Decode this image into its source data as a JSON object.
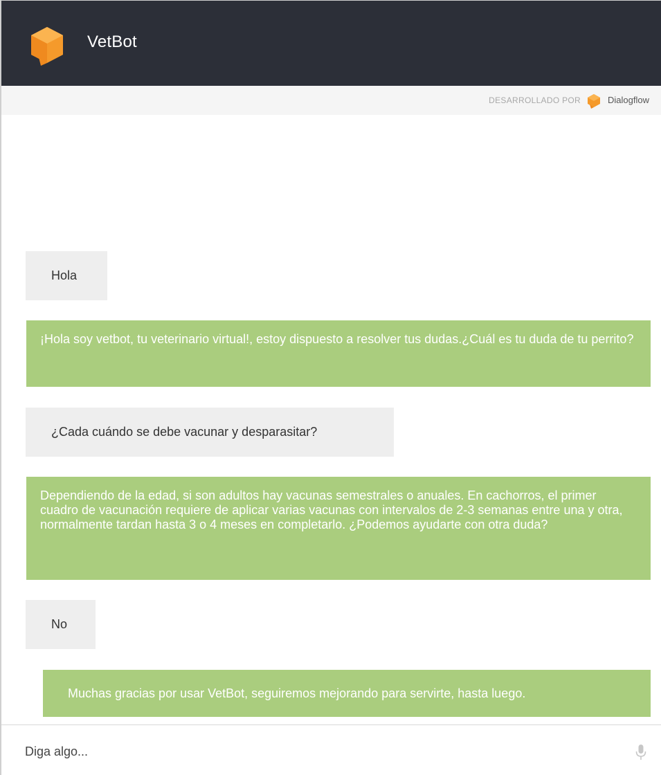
{
  "header": {
    "title": "VetBot",
    "logo_icon": "vetbot-logo-icon"
  },
  "powered_by": {
    "label": "DESARROLLADO POR",
    "brand": "Dialogflow",
    "brand_icon": "dialogflow-logo-icon"
  },
  "messages": [
    {
      "sender": "user",
      "text": "Hola"
    },
    {
      "sender": "bot",
      "text": "¡Hola soy vetbot, tu veterinario virtual!, estoy dispuesto a resolver tus dudas.¿Cuál es tu duda de tu perrito?"
    },
    {
      "sender": "user",
      "text": "¿Cada cuándo se debe vacunar y desparasitar?"
    },
    {
      "sender": "bot",
      "text": "Dependiendo de la edad, si son adultos hay vacunas semestrales o anuales. En cachorros, el primer cuadro de vacunación requiere de aplicar varias vacunas con intervalos de 2-3 semanas entre una y otra, normalmente tardan hasta 3 o 4 meses en completarlo. ¿Podemos ayudarte con otra duda?"
    },
    {
      "sender": "user",
      "text": "No"
    },
    {
      "sender": "bot",
      "text": "Muchas gracias por usar VetBot, seguiremos mejorando para servirte, hasta luego."
    }
  ],
  "input": {
    "placeholder": "Diga algo...",
    "mic_icon": "microphone-icon"
  },
  "colors": {
    "header_bg": "#2c2f38",
    "bot_bubble": "#aacd7e",
    "user_bubble": "#eeeeee",
    "logo_orange": "#f59a2b"
  }
}
